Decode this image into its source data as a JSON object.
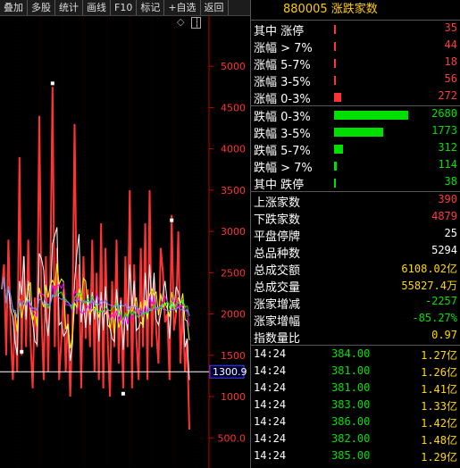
{
  "toolbar": {
    "buttons": [
      "叠加",
      "多股",
      "统计",
      "画线",
      "F10",
      "标记",
      "+自选",
      "返回"
    ]
  },
  "chart": {
    "y_ticks": [
      "5000",
      "4500",
      "4000",
      "3500",
      "3000",
      "2500",
      "2000",
      "1500",
      "1000",
      "500.0"
    ],
    "current_value": "1300.9",
    "colors": {
      "rise": "#ff3333",
      "axis": "#cc0000",
      "ma1": "#ffffff",
      "ma2": "#ffff00",
      "ma3": "#ff00ff",
      "ma4": "#00ff00",
      "ma5": "#8080ff"
    }
  },
  "chart_data": {
    "type": "line",
    "ylim": [
      200,
      5500
    ],
    "y_ticks": [
      5000,
      4500,
      4000,
      3500,
      3000,
      2500,
      2000,
      1500,
      1000,
      500
    ],
    "current_value": 1300.9,
    "series": [
      {
        "values": [
          2300,
          2600,
          1500,
          2900,
          1800,
          1200,
          2000,
          1300,
          3900,
          1500,
          2700,
          1600,
          2900,
          1700,
          1100,
          2200,
          1600,
          4400,
          2000,
          1200,
          2700,
          1300,
          2500,
          4750,
          1600,
          2800,
          1200,
          1700,
          2300,
          1300,
          2000,
          1000,
          1900,
          4300,
          2000,
          2600,
          1100,
          2700,
          1700,
          2300,
          1600,
          2900,
          1300,
          2500,
          1200,
          3100,
          1100,
          2800,
          1700,
          1000,
          2400,
          1600,
          2900,
          1400,
          2200,
          1100,
          2700,
          1600,
          3500,
          1100,
          2600,
          1700,
          1200,
          2800,
          1600,
          3100,
          1200,
          3500,
          1600,
          2400,
          1800,
          1400,
          2800,
          2500,
          1900,
          2000,
          1200,
          3200,
          1800,
          2000,
          3000,
          1400,
          2100,
          1300,
          1700,
          600
        ]
      }
    ]
  },
  "panel": {
    "title": "880005 涨跌家数",
    "rise_rows": [
      {
        "label": "其中 涨停",
        "value": "35",
        "bar": 0.01
      },
      {
        "label": "涨幅 > 7%",
        "value": "44",
        "bar": 0.01
      },
      {
        "label": "涨幅 5-7%",
        "value": "18",
        "bar": 0.01
      },
      {
        "label": "涨幅 3-5%",
        "value": "56",
        "bar": 0.01
      },
      {
        "label": "涨幅 0-3%",
        "value": "272",
        "bar": 0.1
      }
    ],
    "fall_rows": [
      {
        "label": "跌幅 0-3%",
        "value": "2680",
        "bar": 1.0
      },
      {
        "label": "跌幅 3-5%",
        "value": "1773",
        "bar": 0.66
      },
      {
        "label": "跌幅 5-7%",
        "value": "312",
        "bar": 0.12
      },
      {
        "label": "跌幅 > 7%",
        "value": "114",
        "bar": 0.04
      },
      {
        "label": "其中 跌停",
        "value": "38",
        "bar": 0.01
      }
    ],
    "stats": [
      {
        "label": "上涨家数",
        "value": "390",
        "color": "red"
      },
      {
        "label": "下跌家数",
        "value": "4879",
        "color": "red"
      },
      {
        "label": "平盘停牌",
        "value": "25",
        "color": "white"
      },
      {
        "label": "总品种数",
        "value": "5294",
        "color": "white"
      },
      {
        "label": "总成交额",
        "value": "6108.02亿",
        "color": "yellow"
      },
      {
        "label": "总成交量",
        "value": "55827.4万",
        "color": "yellow"
      },
      {
        "label": "涨家增减",
        "value": "-2257",
        "color": "green"
      },
      {
        "label": "涨家增幅",
        "value": "-85.27%",
        "color": "green"
      },
      {
        "label": "指数量比",
        "value": "0.97",
        "color": "yellow"
      }
    ],
    "ticks": [
      {
        "time": "14:24",
        "price": "384.00",
        "amount": "1.27亿"
      },
      {
        "time": "14:24",
        "price": "381.00",
        "amount": "1.26亿"
      },
      {
        "time": "14:24",
        "price": "381.00",
        "amount": "1.41亿"
      },
      {
        "time": "14:24",
        "price": "383.00",
        "amount": "1.33亿"
      },
      {
        "time": "14:24",
        "price": "386.00",
        "amount": "1.42亿"
      },
      {
        "time": "14:24",
        "price": "382.00",
        "amount": "1.48亿"
      },
      {
        "time": "14:24",
        "price": "385.00",
        "amount": "1.29亿"
      }
    ]
  }
}
